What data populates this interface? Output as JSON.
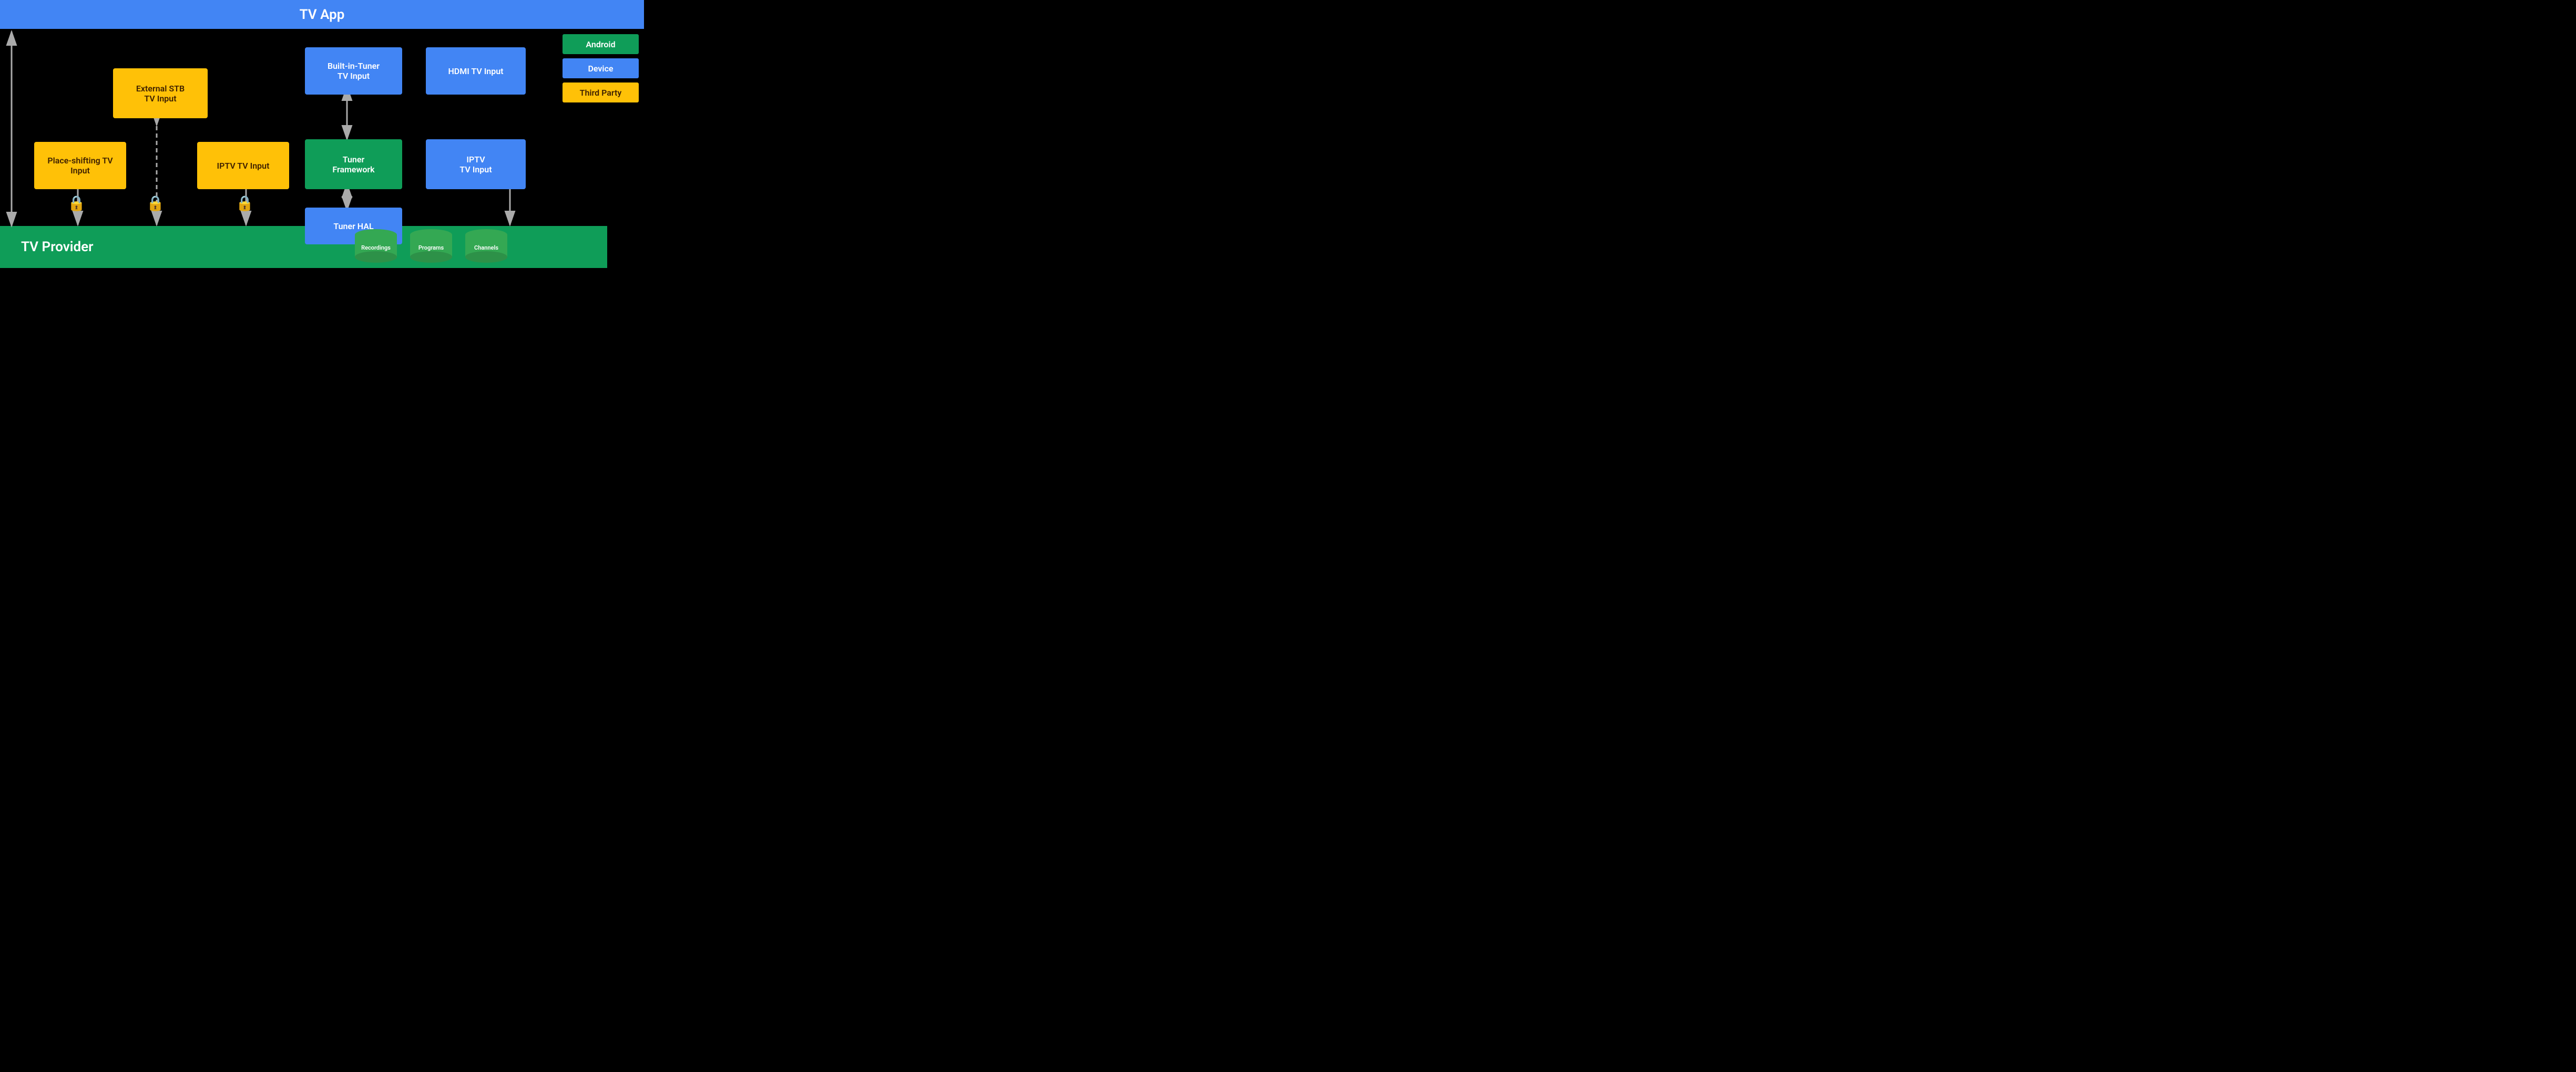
{
  "header": {
    "title": "TV App"
  },
  "footer": {
    "label": "TV Provider"
  },
  "legend": {
    "android": "Android",
    "device": "Device",
    "thirdParty": "Third Party"
  },
  "boxes": {
    "externalSTB": "External STB\nTV Input",
    "placeshifting": "Place-shifting\nTV Input",
    "iptvLeft": "IPTV\nTV Input",
    "builtInTuner": "Built-in-Tuner\nTV Input",
    "tunerFramework": "Tuner\nFramework",
    "tunerHAL": "Tuner HAL",
    "hdmiTVInput": "HDMI TV Input",
    "iptvRight": "IPTV\nTV Input"
  },
  "cylinders": {
    "recordings": "Recordings",
    "programs": "Programs",
    "channels": "Channels"
  },
  "colors": {
    "orange": "#FFC107",
    "blue": "#4285F4",
    "green": "#0F9D58",
    "black": "#000000",
    "white": "#ffffff",
    "gray": "#aaaaaa"
  }
}
